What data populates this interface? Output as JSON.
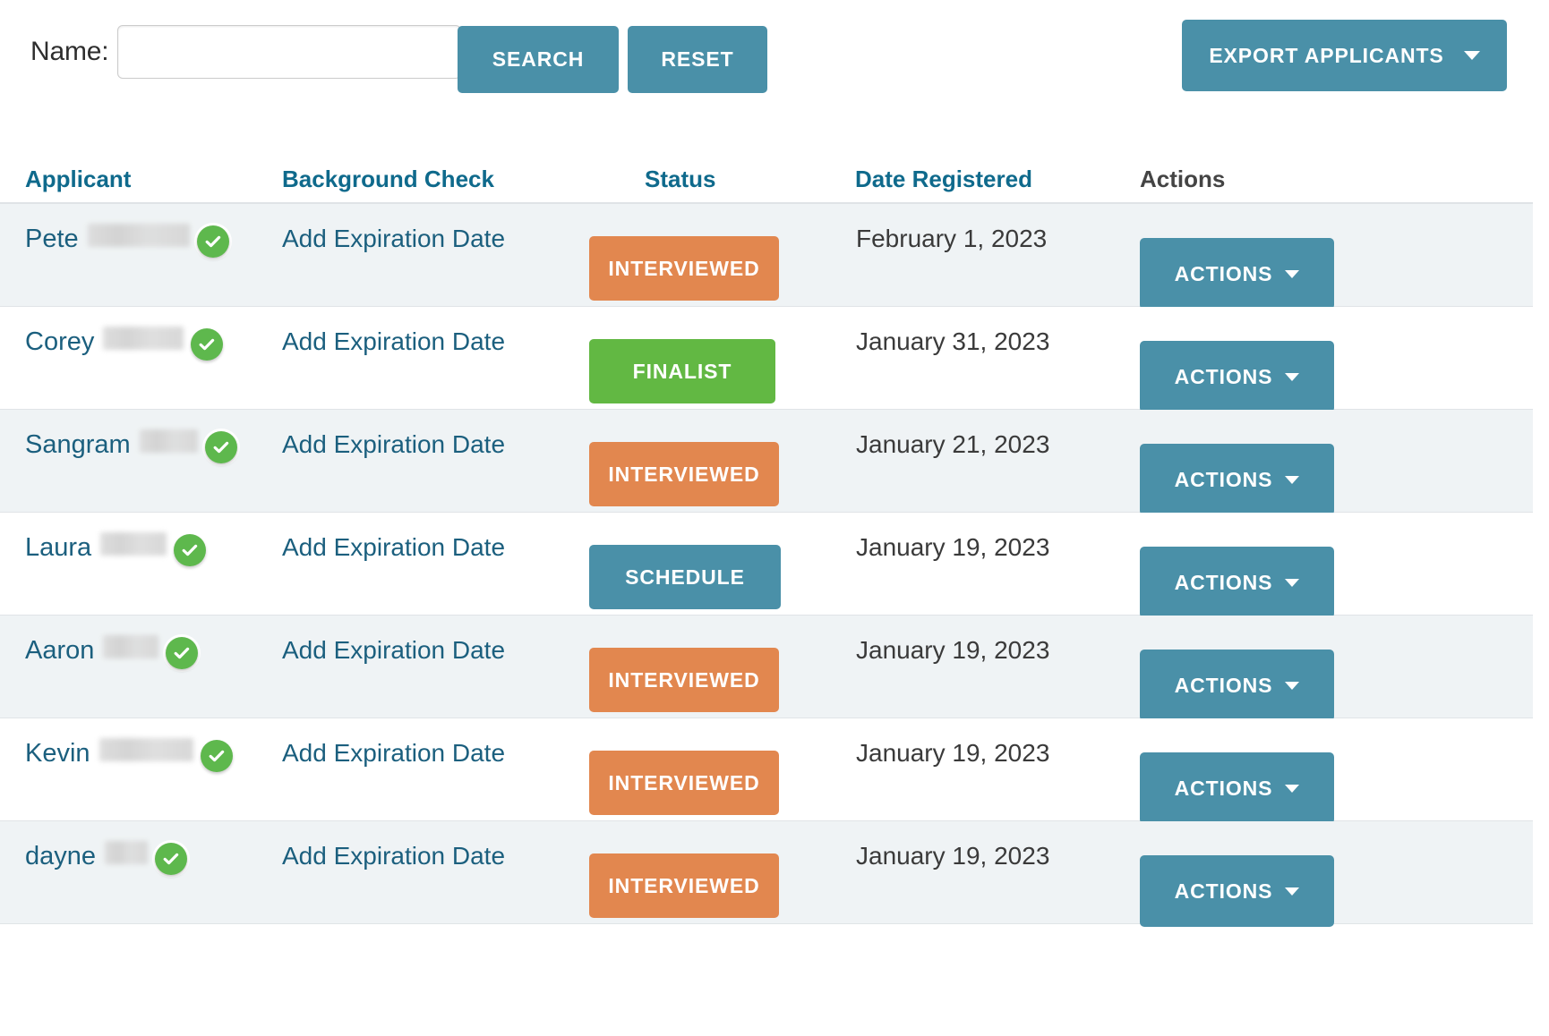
{
  "toolbar": {
    "name_label": "Name:",
    "name_value": "",
    "name_placeholder": "",
    "search_label": "SEARCH",
    "reset_label": "RESET",
    "export_label": "EXPORT APPLICANTS"
  },
  "table": {
    "headers": {
      "applicant": "Applicant",
      "background_check": "Background Check",
      "status": "Status",
      "date_registered": "Date Registered",
      "actions": "Actions"
    },
    "actions_button_label": "ACTIONS",
    "rows": [
      {
        "applicant": "Pete",
        "redacted_width": 114,
        "verified_icon": "green-check-icon",
        "background_check": "Add Expiration Date",
        "status": "INTERVIEWED",
        "status_type": "interviewed",
        "status_width": 212,
        "date_registered": "February 1, 2023",
        "actions": "ACTIONS"
      },
      {
        "applicant": "Corey",
        "redacted_width": 90,
        "verified_icon": "green-check-icon",
        "background_check": "Add Expiration Date",
        "status": "FINALIST",
        "status_type": "finalist",
        "status_width": 208,
        "date_registered": "January 31, 2023",
        "actions": "ACTIONS"
      },
      {
        "applicant": "Sangram",
        "redacted_width": 65,
        "verified_icon": "green-check-icon",
        "background_check": "Add Expiration Date",
        "status": "INTERVIEWED",
        "status_type": "interviewed",
        "status_width": 212,
        "date_registered": "January 21, 2023",
        "actions": "ACTIONS"
      },
      {
        "applicant": "Laura",
        "redacted_width": 74,
        "verified_icon": "green-check-icon",
        "background_check": "Add Expiration Date",
        "status": "SCHEDULE",
        "status_type": "schedule",
        "status_width": 214,
        "date_registered": "January 19, 2023",
        "actions": "ACTIONS"
      },
      {
        "applicant": "Aaron",
        "redacted_width": 62,
        "verified_icon": "green-check-icon",
        "background_check": "Add Expiration Date",
        "status": "INTERVIEWED",
        "status_type": "interviewed",
        "status_width": 212,
        "date_registered": "January 19, 2023",
        "actions": "ACTIONS"
      },
      {
        "applicant": "Kevin",
        "redacted_width": 105,
        "verified_icon": "green-check-icon",
        "background_check": "Add Expiration Date",
        "status": "INTERVIEWED",
        "status_type": "interviewed",
        "status_width": 212,
        "date_registered": "January 19, 2023",
        "actions": "ACTIONS"
      },
      {
        "applicant": "dayne",
        "redacted_width": 48,
        "verified_icon": "green-check-icon",
        "background_check": "Add Expiration Date",
        "status": "INTERVIEWED",
        "status_type": "interviewed",
        "status_width": 212,
        "date_registered": "January 19, 2023",
        "actions": "ACTIONS"
      }
    ]
  },
  "colors": {
    "accent_teal": "#4a90a8",
    "link_teal": "#1b5f7e",
    "header_teal": "#0f6a8c",
    "status_interviewed": "#e2874f",
    "status_finalist": "#62b843",
    "status_schedule": "#4a90a8",
    "verified_green": "#5eb84d",
    "row_stripe": "#eff3f5"
  }
}
